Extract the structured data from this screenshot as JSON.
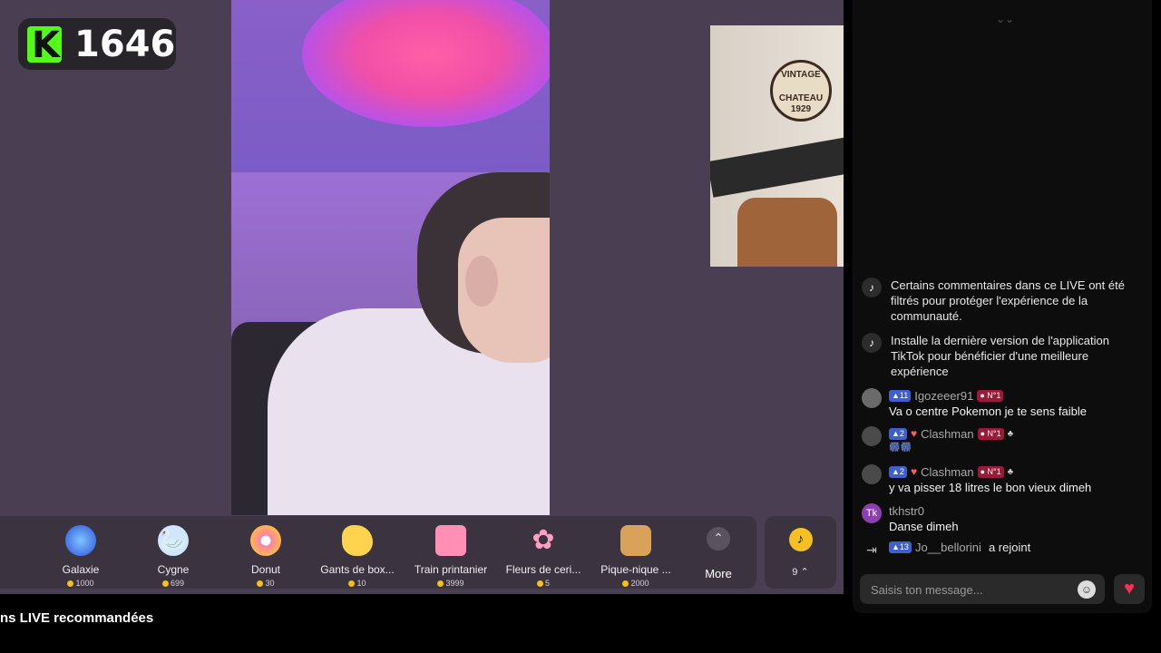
{
  "kick_badge": {
    "count": "1646"
  },
  "gifts": [
    {
      "name": "Galaxie",
      "price": "1000",
      "icon": "galaxy-icon"
    },
    {
      "name": "Cygne",
      "price": "699",
      "icon": "swan-icon"
    },
    {
      "name": "Donut",
      "price": "30",
      "icon": "donut-icon"
    },
    {
      "name": "Gants de box...",
      "price": "10",
      "icon": "boxing-gloves-icon"
    },
    {
      "name": "Train printanier",
      "price": "3999",
      "icon": "train-icon"
    },
    {
      "name": "Fleurs de ceri...",
      "price": "5",
      "icon": "cherry-blossom-icon"
    },
    {
      "name": "Pique-nique ...",
      "price": "2000",
      "icon": "picnic-icon"
    }
  ],
  "more_label": "More",
  "tiktok_gift_count": "9",
  "recommended_label": "ns LIVE recommandées",
  "pip_logo": {
    "line1": "VINTAGE",
    "line2": "CHATEAU",
    "line3": "1929"
  },
  "chat": {
    "system": [
      {
        "text": "Certains commentaires dans ce LIVE ont été filtrés pour protéger l'expérience de la communauté."
      },
      {
        "text": "Installe la dernière version de l'application TikTok pour bénéficier d'une meilleure expérience"
      }
    ],
    "messages": [
      {
        "level": "11",
        "user": "Igozeeer91",
        "rank": "N°1",
        "text": "Va o centre Pokemon je te sens faible"
      },
      {
        "level": "2",
        "user": "Clashman",
        "rank": "N°1",
        "text": "🎆🎆"
      },
      {
        "level": "2",
        "user": "Clashman",
        "rank": "N°1",
        "text": "y va pisser 18 litres le bon vieux dimeh"
      },
      {
        "avatar": "Tk",
        "user": "tkhstr0",
        "text": "Danse dimeh"
      }
    ],
    "join": {
      "level": "13",
      "user": "Jo__bellorini",
      "action": "a rejoint"
    },
    "input_placeholder": "Saisis ton message...",
    "colors": {
      "level_badge": "#3f5fcc",
      "rank_badge": "#9a1a3a",
      "like": "#ff2d55"
    }
  }
}
